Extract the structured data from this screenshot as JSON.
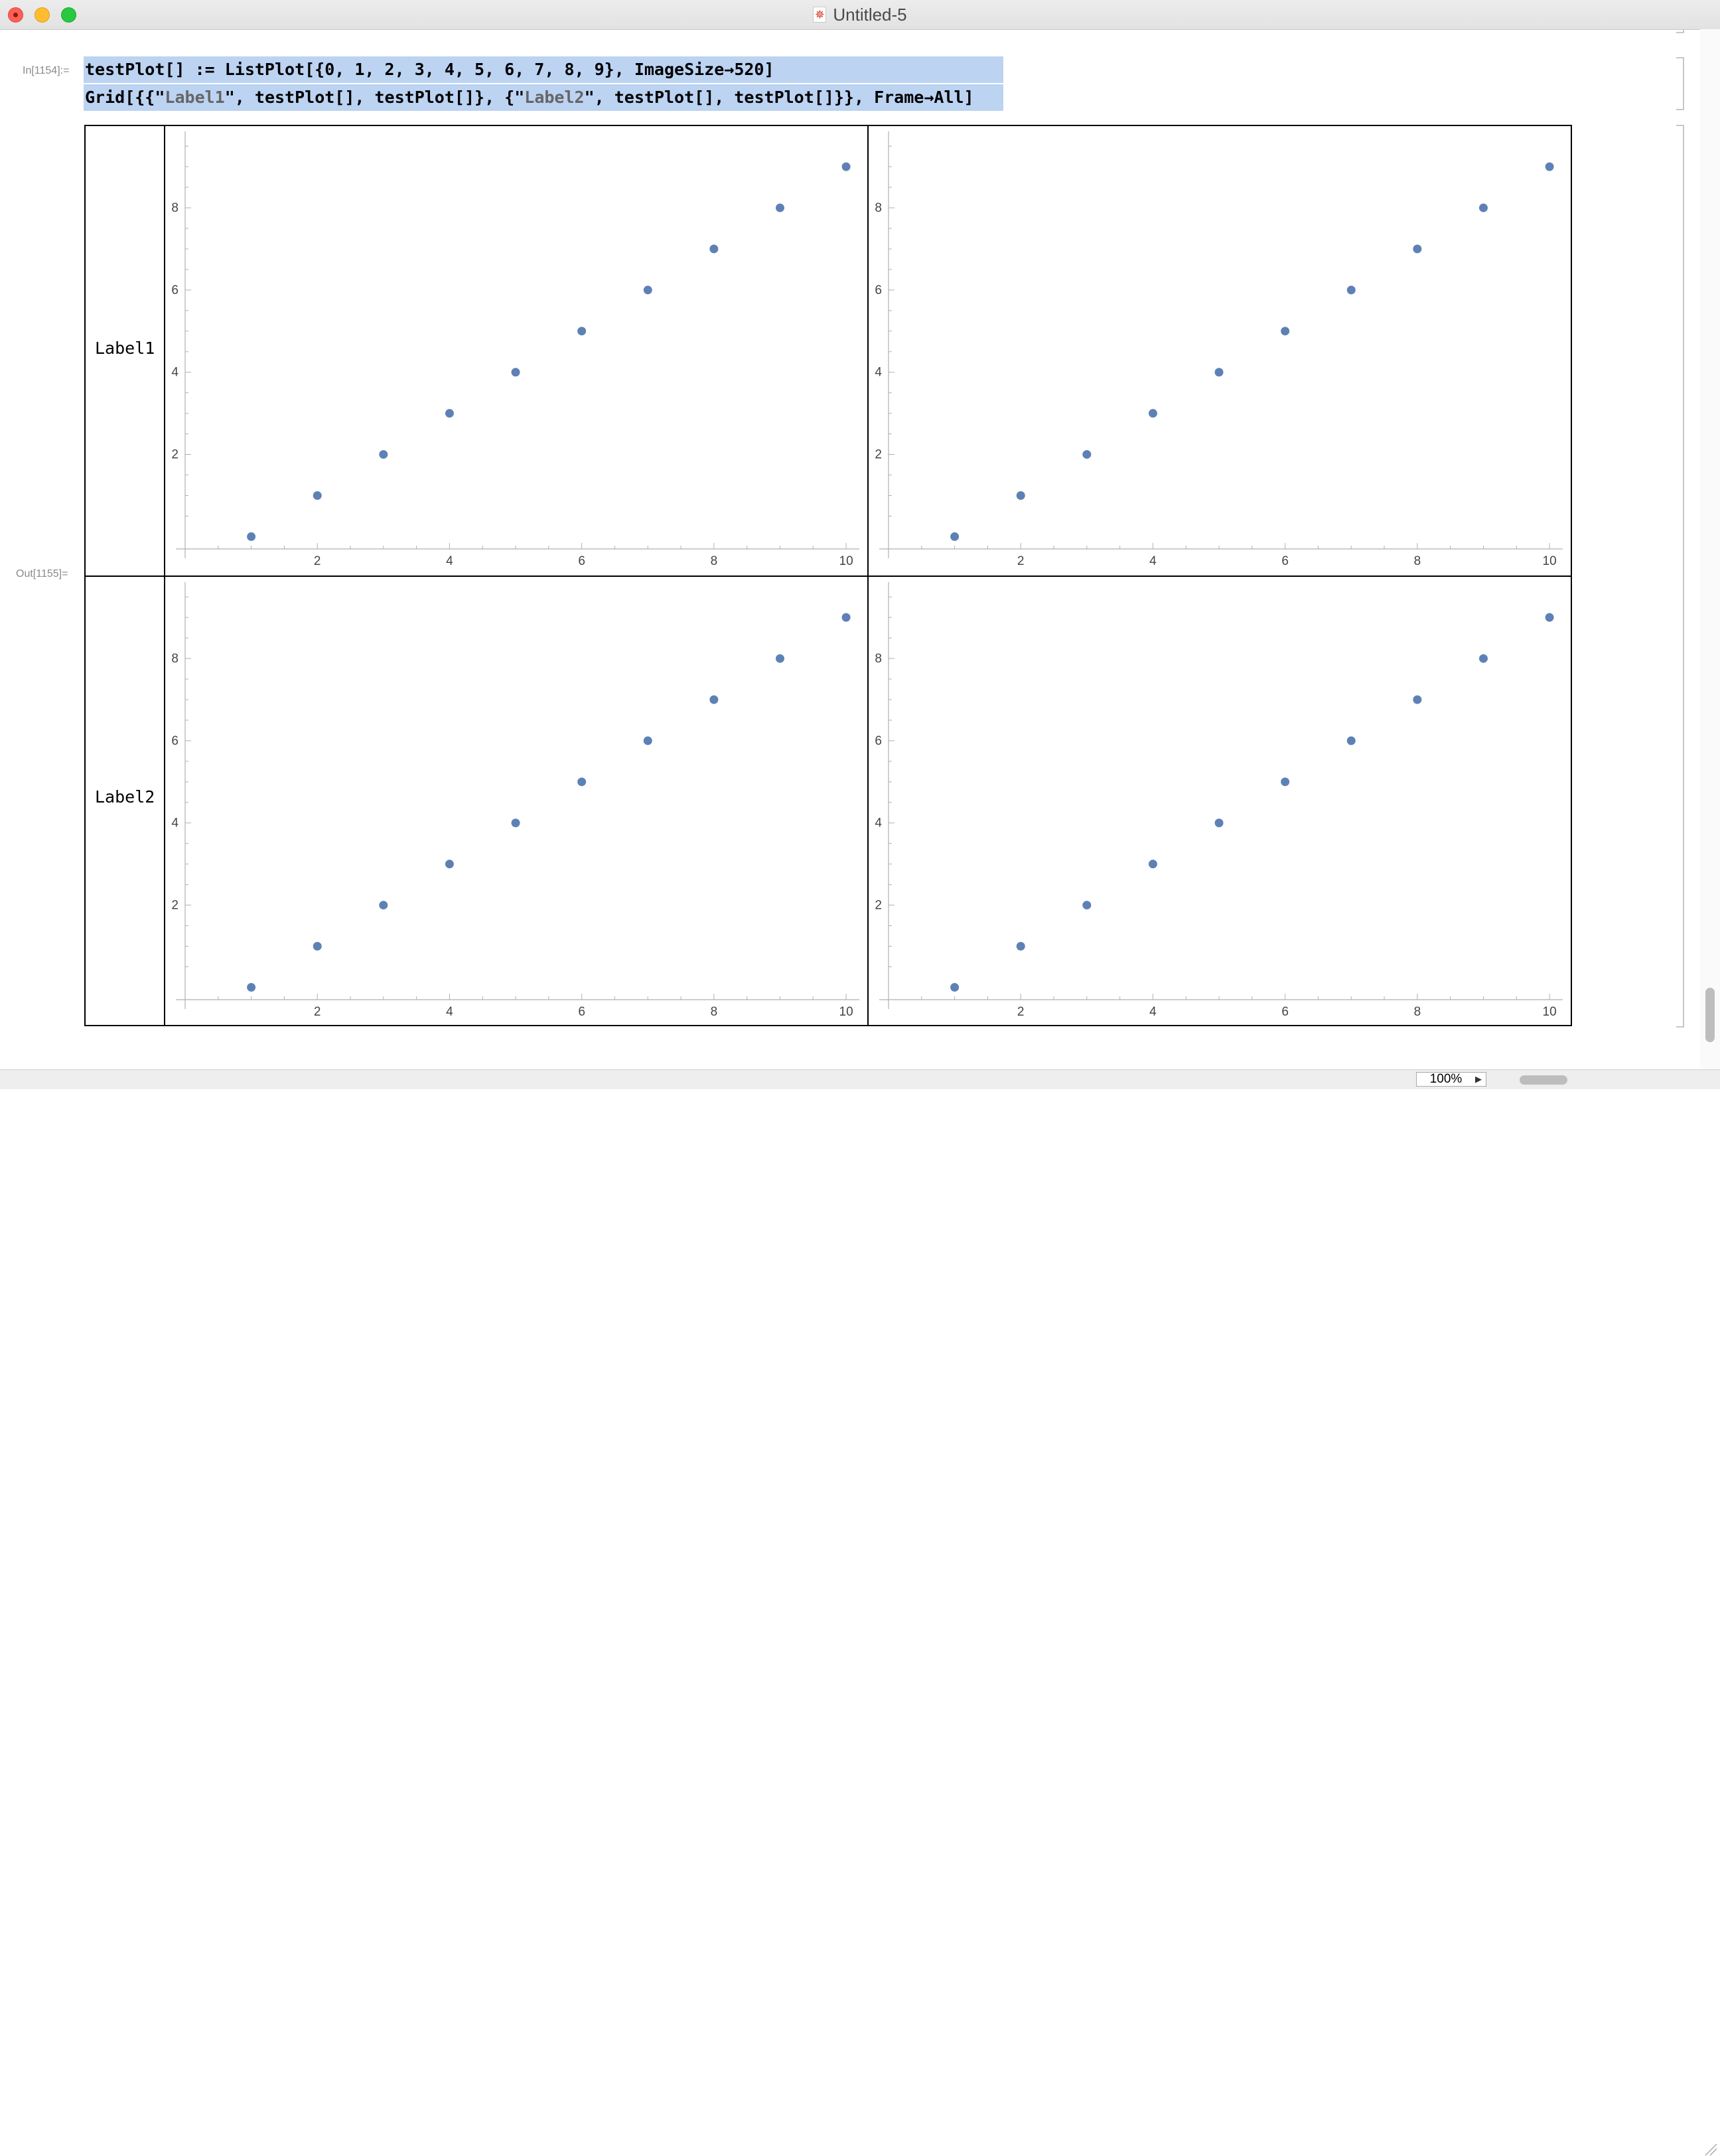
{
  "window": {
    "title": "Untitled-5",
    "doc_icon": "mathematica-notebook-icon"
  },
  "cells": {
    "input_label": "In[1154]:=",
    "output_label": "Out[1155]=",
    "code_line_1": [
      {
        "t": "testPlot[] := ListPlot[{0, 1, 2, 3, 4, 5, 6, 7, 8, 9}, ImageSize→520]",
        "s": false
      }
    ],
    "code_line_2": [
      {
        "t": "Grid[{{\"",
        "s": false
      },
      {
        "t": "Label1",
        "s": true
      },
      {
        "t": "\", testPlot[], testPlot[]}, {\"",
        "s": false
      },
      {
        "t": "Label2",
        "s": true
      },
      {
        "t": "\", testPlot[], testPlot[]}}, Frame→All]",
        "s": false
      }
    ]
  },
  "grid": {
    "row_labels": [
      "Label1",
      "Label2"
    ]
  },
  "chart_data": [
    {
      "type": "scatter",
      "x": [
        1,
        2,
        3,
        4,
        5,
        6,
        7,
        8,
        9,
        10
      ],
      "y": [
        0,
        1,
        2,
        3,
        4,
        5,
        6,
        7,
        8,
        9
      ],
      "xticks": [
        2,
        4,
        6,
        8,
        10
      ],
      "yticks": [
        2,
        4,
        6,
        8
      ],
      "xlim": [
        0,
        10.2
      ],
      "ylim": [
        -0.3,
        9.6
      ],
      "color": "#5e81b5"
    },
    {
      "type": "scatter",
      "x": [
        1,
        2,
        3,
        4,
        5,
        6,
        7,
        8,
        9,
        10
      ],
      "y": [
        0,
        1,
        2,
        3,
        4,
        5,
        6,
        7,
        8,
        9
      ],
      "xticks": [
        2,
        4,
        6,
        8,
        10
      ],
      "yticks": [
        2,
        4,
        6,
        8
      ],
      "xlim": [
        0,
        10.2
      ],
      "ylim": [
        -0.3,
        9.6
      ],
      "color": "#5e81b5"
    },
    {
      "type": "scatter",
      "x": [
        1,
        2,
        3,
        4,
        5,
        6,
        7,
        8,
        9,
        10
      ],
      "y": [
        0,
        1,
        2,
        3,
        4,
        5,
        6,
        7,
        8,
        9
      ],
      "xticks": [
        2,
        4,
        6,
        8,
        10
      ],
      "yticks": [
        2,
        4,
        6,
        8
      ],
      "xlim": [
        0,
        10.2
      ],
      "ylim": [
        -0.3,
        9.6
      ],
      "color": "#5e81b5"
    },
    {
      "type": "scatter",
      "x": [
        1,
        2,
        3,
        4,
        5,
        6,
        7,
        8,
        9,
        10
      ],
      "y": [
        0,
        1,
        2,
        3,
        4,
        5,
        6,
        7,
        8,
        9
      ],
      "xticks": [
        2,
        4,
        6,
        8,
        10
      ],
      "yticks": [
        2,
        4,
        6,
        8
      ],
      "xlim": [
        0,
        10.2
      ],
      "ylim": [
        -0.3,
        9.6
      ],
      "color": "#5e81b5"
    }
  ],
  "statusbar": {
    "zoom": "100%",
    "zoom_arrow_icon": "triangle-right-icon"
  }
}
